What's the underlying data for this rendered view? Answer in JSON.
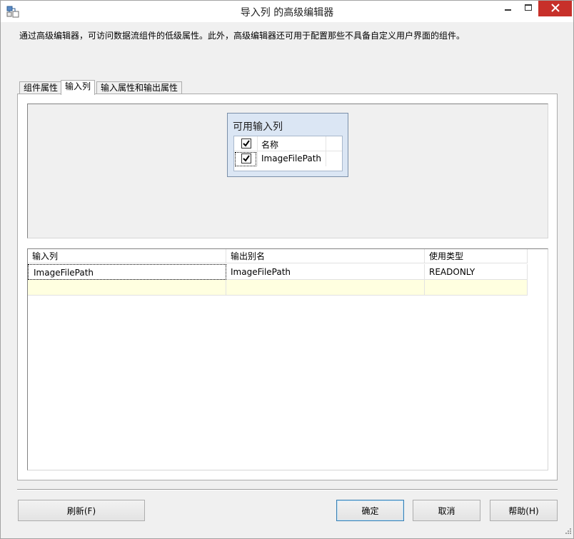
{
  "window": {
    "title": "导入列 的高级编辑器",
    "accent_close": "#c7302a"
  },
  "description": "通过高级编辑器，可访问数据流组件的低级属性。此外，高级编辑器还可用于配置那些不具备自定义用户界面的组件。",
  "tabs": [
    {
      "label": "组件属性",
      "active": false
    },
    {
      "label": "输入列",
      "active": true
    },
    {
      "label": "输入属性和输出属性",
      "active": false
    }
  ],
  "available_columns": {
    "title": "可用输入列",
    "header_label": "名称",
    "header_checked": true,
    "items": [
      {
        "label": "ImageFilePath",
        "checked": true
      }
    ]
  },
  "grid": {
    "headers": [
      "输入列",
      "输出别名",
      "使用类型"
    ],
    "rows": [
      {
        "input_column": "ImageFilePath",
        "output_alias": "ImageFilePath",
        "usage_type": "READONLY"
      }
    ],
    "new_row_color": "#ffffe0"
  },
  "buttons": {
    "refresh": "刷新(F)",
    "ok": "确定",
    "cancel": "取消",
    "help": "帮助(H)"
  },
  "icons": {
    "app": "advanced-editor-icon",
    "minimize": "minimize-icon",
    "maximize": "maximize-icon",
    "close": "close-icon"
  }
}
